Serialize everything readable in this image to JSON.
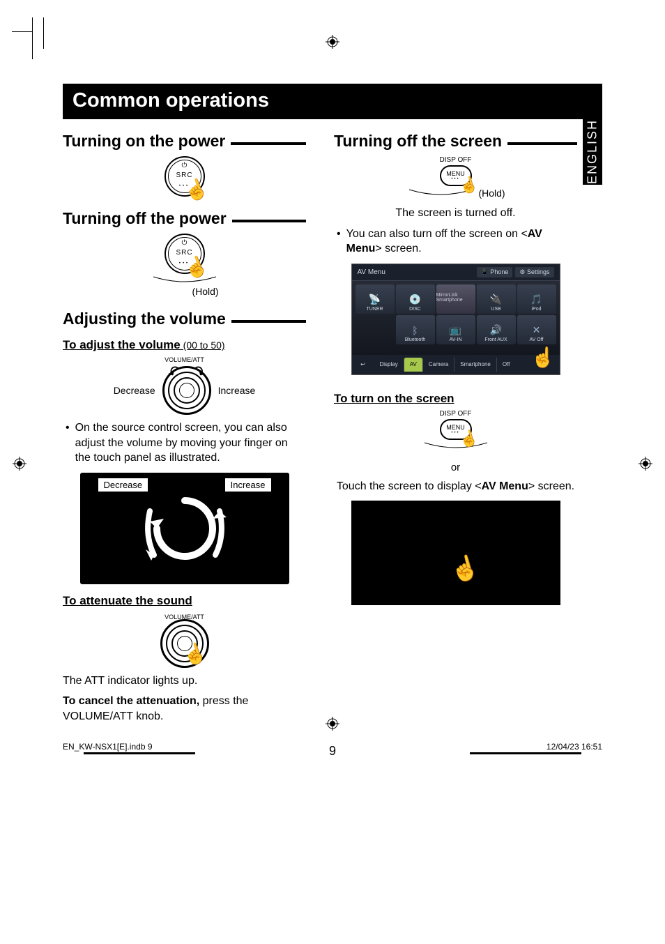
{
  "header": {
    "title": "Common operations"
  },
  "sideTab": "ENGLISH",
  "left": {
    "section1": {
      "title": "Turning on the power"
    },
    "section2": {
      "title": "Turning off the power",
      "hold": "(Hold)"
    },
    "section3": {
      "title": "Adjusting the volume",
      "sub1": "To adjust the volume",
      "sub1note": " (00 to 50)",
      "decrease": "Decrease",
      "increase": "Increase",
      "volatt": "VOLUME/ATT",
      "bullet1": "On the source control screen, you can also adjust the volume by moving your finger on the touch panel as illustrated.",
      "panelDecrease": "Decrease",
      "panelIncrease": "Increase",
      "sub2": "To attenuate the sound",
      "volatt2": "VOLUME/ATT",
      "attLine": "The ATT indicator lights up.",
      "cancelLead": "To cancel the attenuation,",
      "cancelTail": " press the VOLUME/ATT knob."
    }
  },
  "right": {
    "section1": {
      "title": "Turning off the screen",
      "dispOff": "DISP OFF",
      "menu": "MENU",
      "hold": "(Hold)",
      "note1": "The screen is turned off.",
      "bullet1a": "You can also turn off the screen on <",
      "bullet1b": "AV Menu",
      "bullet1c": "> screen."
    },
    "avmenu": {
      "title": "AV Menu",
      "phone": "Phone",
      "settings": "Settings",
      "tuner": "TUNER",
      "disc": "DISC",
      "mirrorlink": "MirrorLink Smartphone",
      "usb": "USB",
      "ipod": "iPod",
      "bluetooth": "Bluetooth",
      "avin": "AV-IN",
      "frontaux": "Front AUX",
      "avoff": "AV Off",
      "display": "Display",
      "av": "AV",
      "camera": "Camera",
      "smartphone": "Smartphone",
      "off": "Off"
    },
    "section2": {
      "title": "To turn on the screen",
      "dispOff": "DISP OFF",
      "menu": "MENU",
      "or": "or",
      "touchLineA": "Touch the screen to display <",
      "touchLineB": "AV Menu",
      "touchLineC": "> screen."
    }
  },
  "button": {
    "src": "SRC"
  },
  "pageNumber": "9",
  "footer": {
    "left": "EN_KW-NSX1[E].indb   9",
    "right": "12/04/23   16:51"
  }
}
